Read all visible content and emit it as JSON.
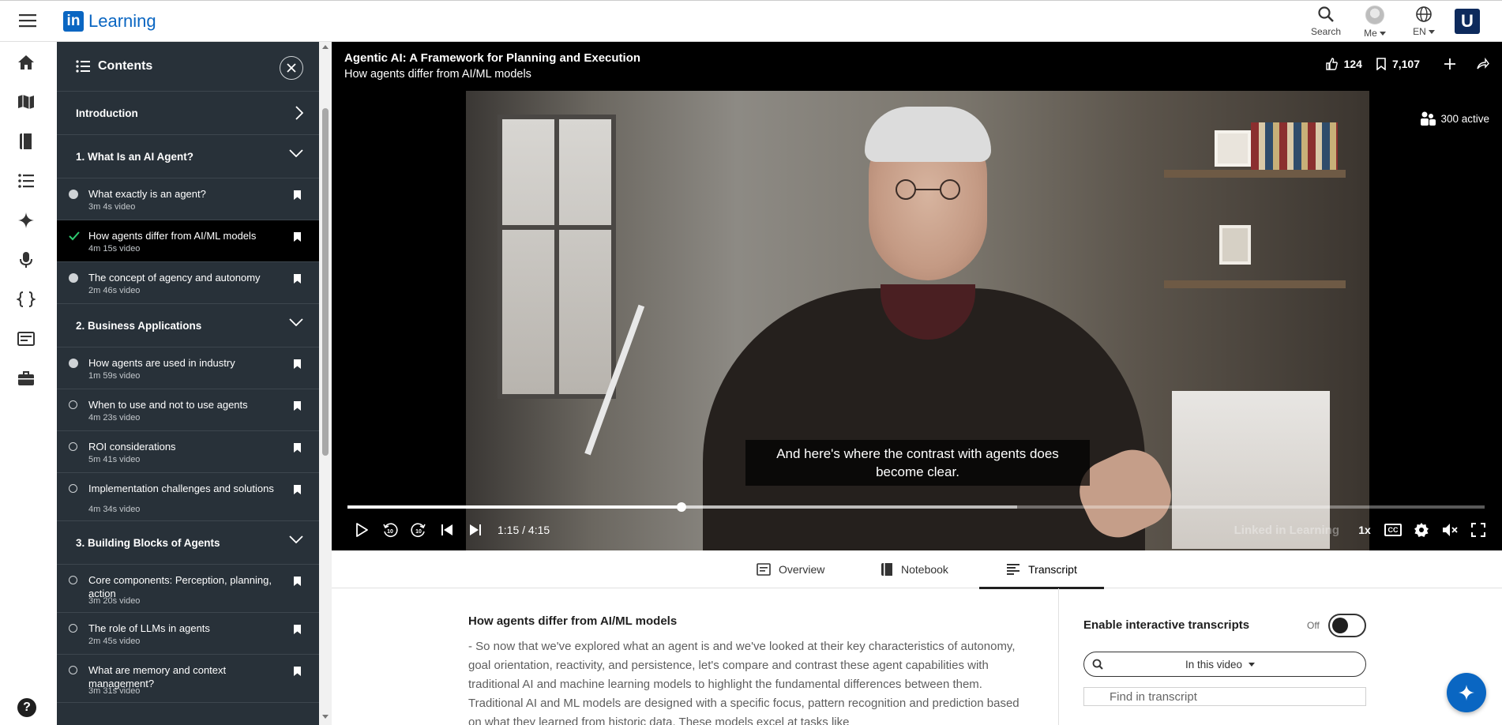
{
  "app": {
    "logo_letters": "in",
    "logo_text": "Learning",
    "org_logo_letter": "U"
  },
  "top_nav": {
    "search_label": "Search",
    "me_label": "Me",
    "language_label": "EN"
  },
  "contents": {
    "title": "Contents",
    "sections": [
      {
        "title": "Introduction",
        "expanded": false,
        "items": []
      },
      {
        "title": "1. What Is an AI Agent?",
        "expanded": true,
        "items": [
          {
            "title": "What exactly is an agent?",
            "meta": "3m 4s video",
            "status": "in-progress",
            "active": false
          },
          {
            "title": "How agents differ from AI/ML models",
            "meta": "4m 15s video",
            "status": "current",
            "active": true
          },
          {
            "title": "The concept of agency and autonomy",
            "meta": "2m 46s video",
            "status": "in-progress",
            "active": false
          }
        ]
      },
      {
        "title": "2. Business Applications",
        "expanded": true,
        "items": [
          {
            "title": "How agents are used in industry",
            "meta": "1m 59s video",
            "status": "in-progress",
            "active": false
          },
          {
            "title": "When to use and not to use agents",
            "meta": "4m 23s video",
            "status": "not-started",
            "active": false
          },
          {
            "title": "ROI considerations",
            "meta": "5m 41s video",
            "status": "not-started",
            "active": false
          },
          {
            "title": "Implementation challenges and solutions",
            "meta": "4m 34s video",
            "status": "not-started",
            "active": false
          }
        ]
      },
      {
        "title": "3. Building Blocks of Agents",
        "expanded": true,
        "items": [
          {
            "title": "Core components: Perception, planning, action",
            "meta": "3m 20s video",
            "status": "not-started",
            "active": false
          },
          {
            "title": "The role of LLMs in agents",
            "meta": "2m 45s video",
            "status": "not-started",
            "active": false
          },
          {
            "title": "What are memory and context management?",
            "meta": "3m 31s video",
            "status": "not-started",
            "active": false
          }
        ]
      }
    ]
  },
  "player": {
    "course_title": "Agentic AI: A Framework for Planning and Execution",
    "video_title": "How agents differ from AI/ML models",
    "likes": "124",
    "saves": "7,107",
    "active_viewers": "300 active",
    "caption": "And here's where the contrast with agents does become clear.",
    "time": "1:15 / 4:15",
    "progress_fraction": 0.294,
    "buffered_fraction": 0.589,
    "watermark": "Linked in Learning",
    "speed": "1x",
    "cc_label": "CC"
  },
  "tabs": [
    {
      "label": "Overview",
      "icon": "overview-icon",
      "selected": false
    },
    {
      "label": "Notebook",
      "icon": "notebook-icon",
      "selected": false
    },
    {
      "label": "Transcript",
      "icon": "transcript-icon",
      "selected": true
    }
  ],
  "transcript": {
    "title": "How agents differ from AI/ML models",
    "text": "- So now that we've explored what an agent is and we've looked at their key characteristics of autonomy, goal orientation, reactivity, and persistence, let's compare and contrast these agent capabilities with traditional AI and machine learning models to highlight the fundamental differences between them. Traditional AI and ML models are designed with a specific focus, pattern recognition and prediction based on what they learned from historic data. These models excel at tasks like",
    "enable_label": "Enable interactive transcripts",
    "toggle_state": "Off",
    "scope": "In this video",
    "find_placeholder": "Find in transcript"
  },
  "colors": {
    "brand": "#0a66c2",
    "sidebar_bg": "#283139",
    "check": "#2ecc71"
  }
}
